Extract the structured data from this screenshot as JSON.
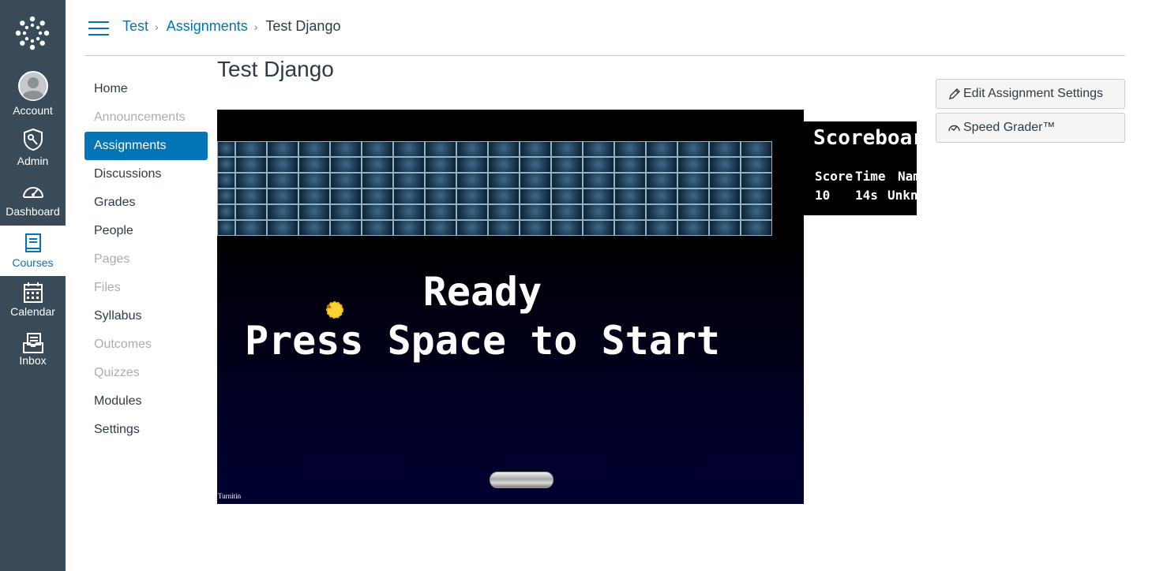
{
  "global_nav": {
    "items": [
      {
        "label": "Account",
        "icon": "account-icon"
      },
      {
        "label": "Admin",
        "icon": "admin-shield-icon"
      },
      {
        "label": "Dashboard",
        "icon": "dashboard-gauge-icon"
      },
      {
        "label": "Courses",
        "icon": "courses-book-icon",
        "active": true
      },
      {
        "label": "Calendar",
        "icon": "calendar-icon"
      },
      {
        "label": "Inbox",
        "icon": "inbox-icon"
      }
    ]
  },
  "breadcrumb": {
    "items": [
      "Test",
      "Assignments",
      "Test Django"
    ],
    "separator": "›"
  },
  "course_nav": {
    "items": [
      {
        "label": "Home",
        "state": "enabled"
      },
      {
        "label": "Announcements",
        "state": "disabled"
      },
      {
        "label": "Assignments",
        "state": "active"
      },
      {
        "label": "Discussions",
        "state": "enabled"
      },
      {
        "label": "Grades",
        "state": "enabled"
      },
      {
        "label": "People",
        "state": "enabled"
      },
      {
        "label": "Pages",
        "state": "disabled"
      },
      {
        "label": "Files",
        "state": "disabled"
      },
      {
        "label": "Syllabus",
        "state": "enabled"
      },
      {
        "label": "Outcomes",
        "state": "disabled"
      },
      {
        "label": "Quizzes",
        "state": "disabled"
      },
      {
        "label": "Modules",
        "state": "enabled"
      },
      {
        "label": "Settings",
        "state": "enabled"
      }
    ]
  },
  "page_title": "Test Django",
  "game": {
    "line1": "Ready",
    "line2": "Press Space to Start",
    "footer": "Turnitin"
  },
  "scoreboard": {
    "title": "Scoreboard",
    "headers": [
      "Score",
      "Time",
      "Name"
    ],
    "row": [
      "10",
      "14s",
      "Unknown"
    ]
  },
  "sidebar": {
    "edit_label": "Edit Assignment Settings",
    "speed_grader_label": "Speed Grader™"
  },
  "colors": {
    "nav_bg": "#394b58",
    "accent": "#0374b5",
    "text": "#2d3b45",
    "disabled_text": "#a5afb5"
  }
}
